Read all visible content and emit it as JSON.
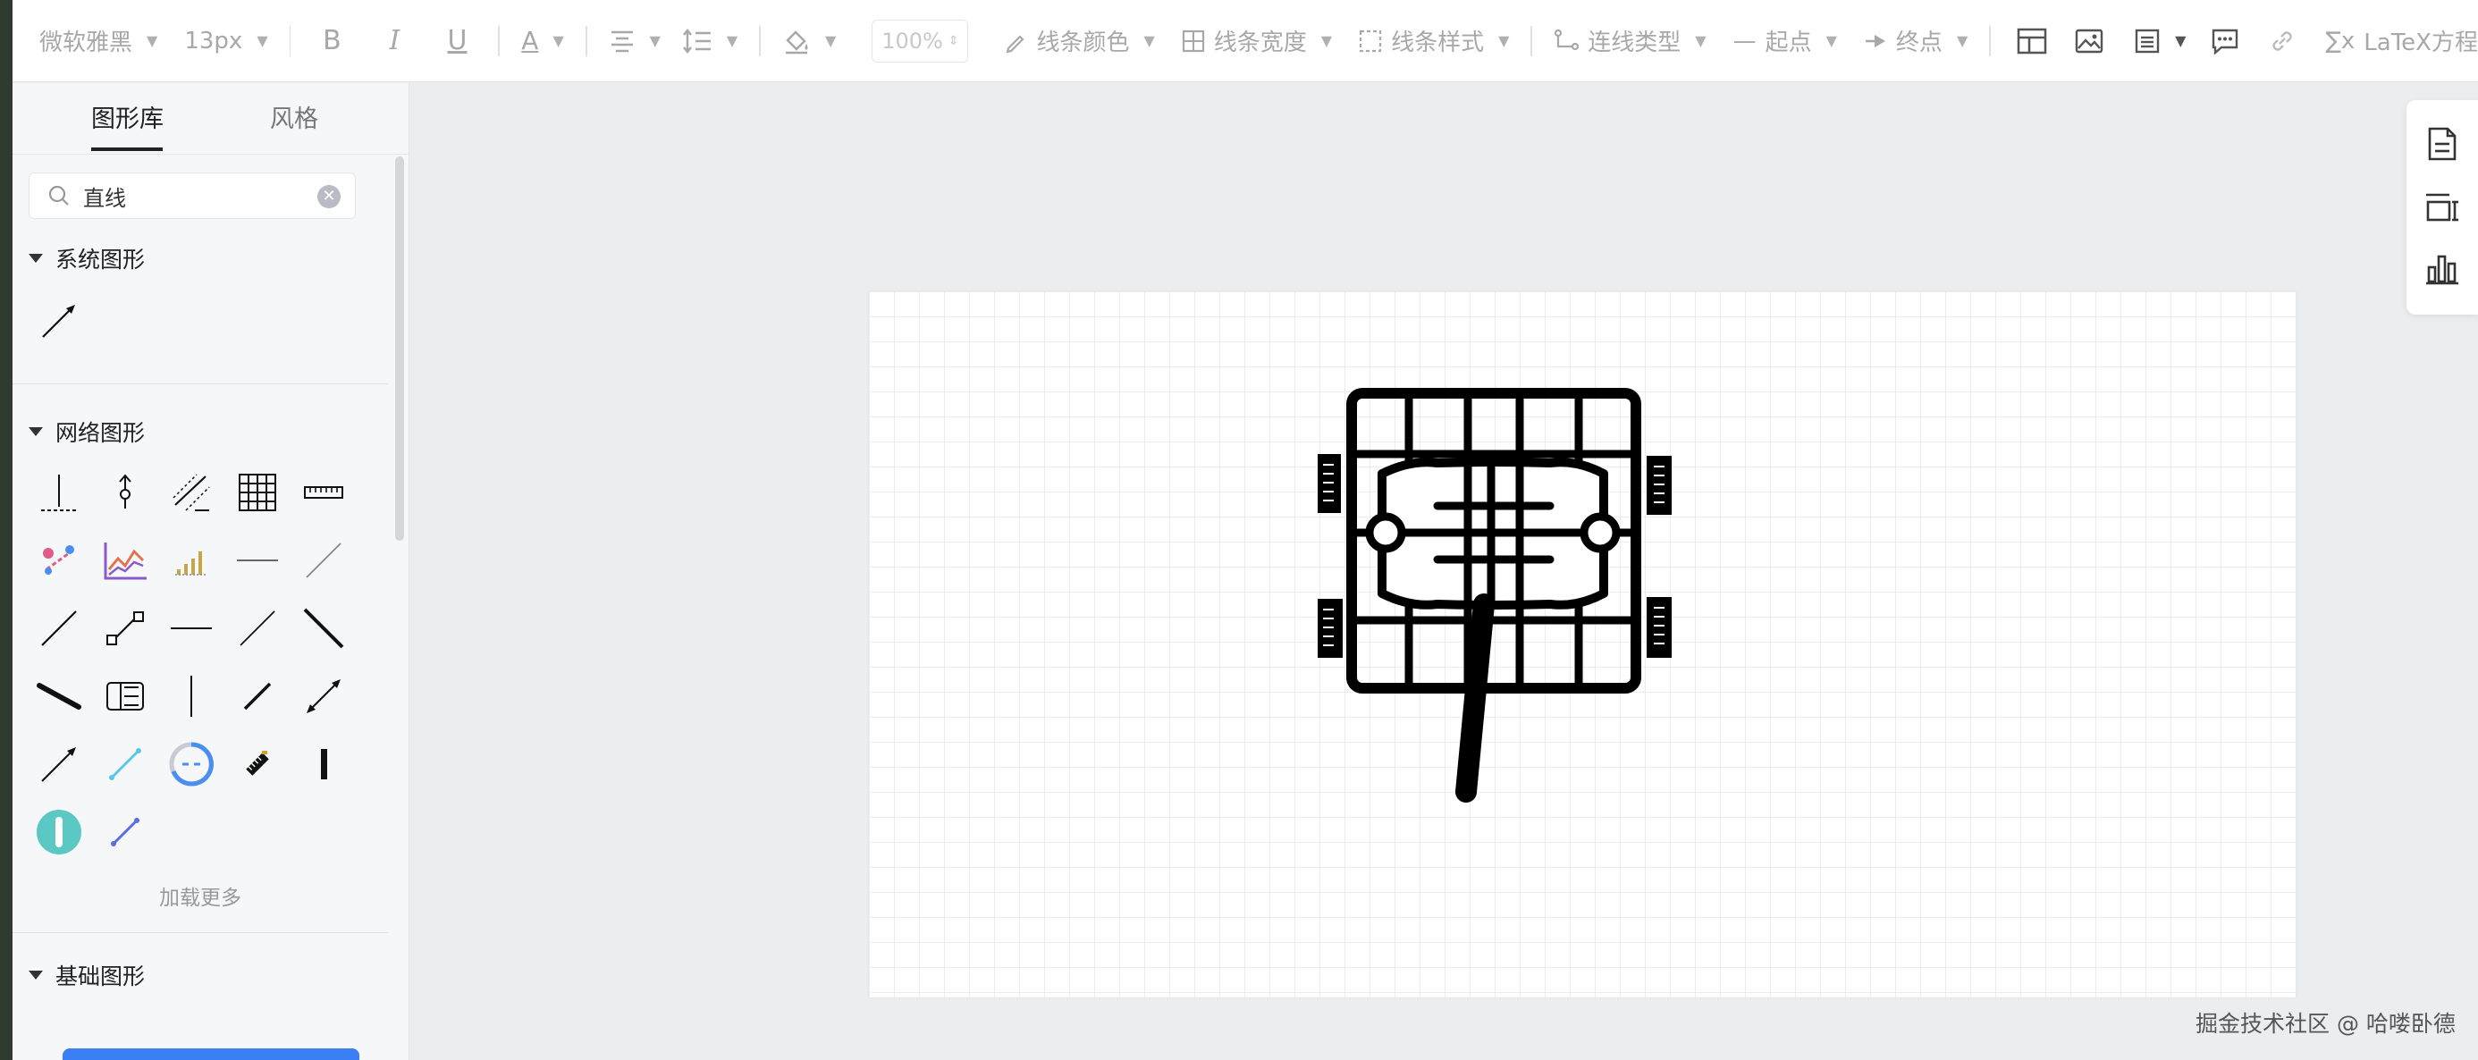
{
  "toolbar": {
    "font_family": "微软雅黑",
    "font_size": "13px",
    "bold": "B",
    "italic": "I",
    "underline": "U",
    "font_color": "A",
    "opacity": "100%",
    "line_color": "线条颜色",
    "line_width": "线条宽度",
    "line_style": "线条样式",
    "connector_type": "连线类型",
    "start_point": "起点",
    "end_point": "终点",
    "latex": "LaTeX方程"
  },
  "sidebar": {
    "tab_library": "图形库",
    "tab_style": "风格",
    "search_value": "直线",
    "sections": {
      "system": "系统图形",
      "network": "网络图形",
      "basic": "基础图形"
    },
    "load_more": "加载更多"
  },
  "watermark": "掘金技术社区 @ 哈喽卧德",
  "colors": {
    "accent_blue": "#3b7ff5",
    "teal": "#5cc8c4",
    "purple": "#8b5cc9"
  }
}
